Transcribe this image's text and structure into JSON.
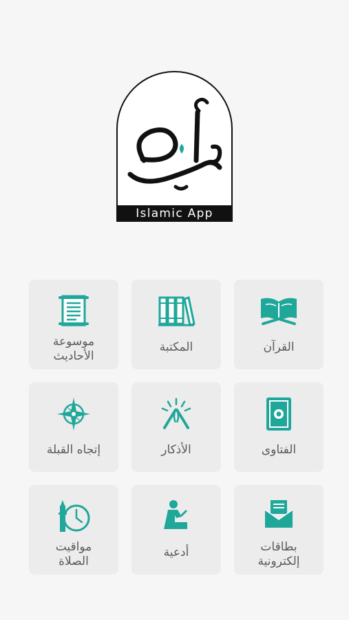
{
  "app": {
    "brand_label": "Islamic App",
    "accent": "#1fa79a"
  },
  "menu": {
    "items": [
      {
        "label": "موسوعة\nالأحاديث",
        "icon": "scroll-icon"
      },
      {
        "label": "المكتبة",
        "icon": "books-icon"
      },
      {
        "label": "القرآن",
        "icon": "open-quran-icon"
      },
      {
        "label": "إتجاه القبلة",
        "icon": "compass-icon"
      },
      {
        "label": "الأذكار",
        "icon": "praying-hands-icon"
      },
      {
        "label": "الفتاوى",
        "icon": "book-cover-icon"
      },
      {
        "label": "مواقيت\nالصلاة",
        "icon": "clock-minaret-icon"
      },
      {
        "label": "أدعية",
        "icon": "praying-person-icon"
      },
      {
        "label": "بطاقات\nإلكترونية",
        "icon": "envelope-card-icon"
      }
    ]
  }
}
